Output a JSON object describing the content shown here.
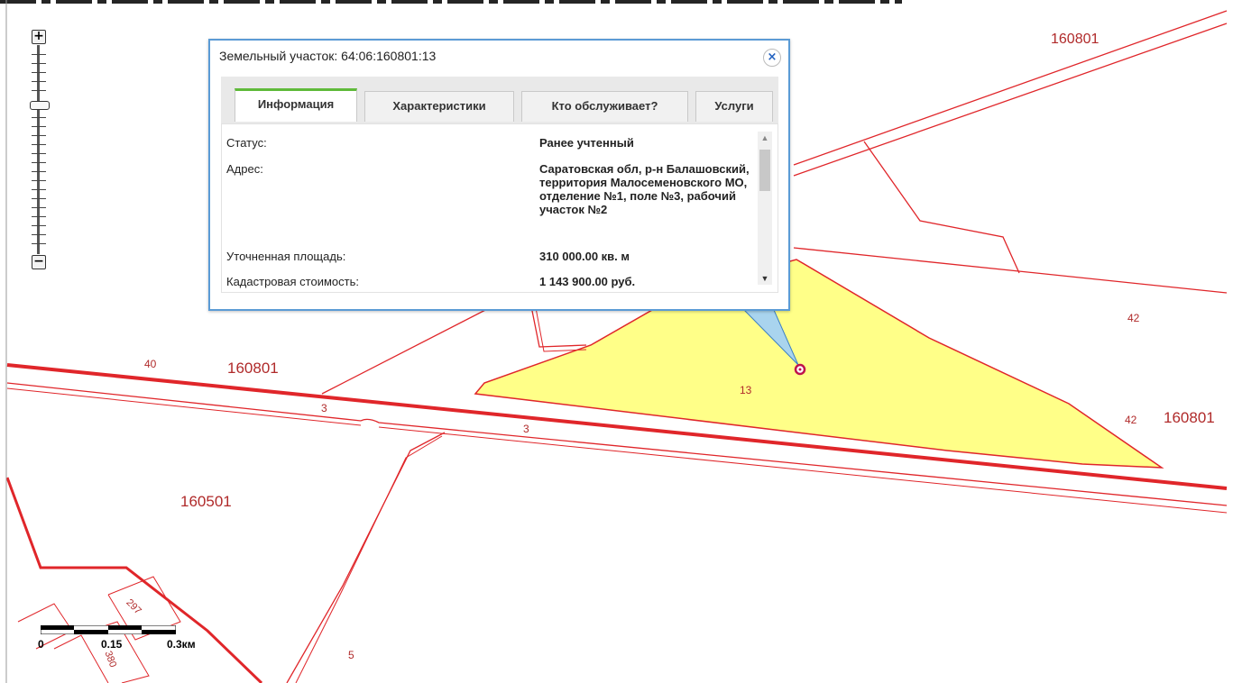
{
  "popup": {
    "title": "Земельный участок: 64:06:160801:13",
    "close_icon": "×",
    "tabs": [
      {
        "label": "Информация",
        "active": true
      },
      {
        "label": "Характеристики",
        "active": false
      },
      {
        "label": "Кто обслуживает?",
        "active": false
      },
      {
        "label": "Услуги",
        "active": false
      }
    ],
    "rows": [
      {
        "label": "Статус:",
        "value": "Ранее учтенный"
      },
      {
        "label": "Адрес:",
        "value": "Саратовская обл, р-н Балашовский, территория Малосеменовского МО, отделение №1, поле №3, рабочий участок №2"
      },
      {
        "label": "Уточненная площадь:",
        "value": "310 000.00 кв. м"
      },
      {
        "label": "Кадастровая стоимость:",
        "value": "1 143 900.00 руб."
      }
    ],
    "scroll_up_icon": "▲",
    "scroll_down_icon": "▼"
  },
  "zoom": {
    "in_label": "+",
    "out_label": "−"
  },
  "map_labels": {
    "q_160801_top": "160801",
    "q_160801_left": "160801",
    "q_160801_right": "160801",
    "q_160501": "160501",
    "n40": "40",
    "n42_upper": "42",
    "n42_lower": "42",
    "n13": "13",
    "n3_a": "3",
    "n3_b": "3",
    "n5": "5",
    "n297": "297",
    "n380": "380"
  },
  "scale": {
    "zero": "0",
    "mid": "0.15",
    "max": "0.3км"
  },
  "colors": {
    "boundary": "#e0262a",
    "parcel_fill": "#ffff88",
    "popup_border": "#5b9bd5",
    "active_tab": "#5fba3a"
  }
}
